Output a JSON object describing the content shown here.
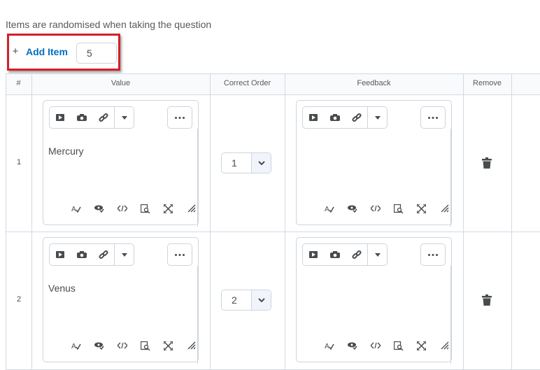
{
  "note": "Items are randomised when taking the question",
  "add_item": {
    "label": "Add Item",
    "plus": "+",
    "count": "5"
  },
  "table": {
    "headers": {
      "num": "#",
      "value": "Value",
      "order": "Correct Order",
      "feedback": "Feedback",
      "remove": "Remove"
    },
    "rows": [
      {
        "num": "1",
        "value": "Mercury",
        "order": "1",
        "feedback": ""
      },
      {
        "num": "2",
        "value": "Venus",
        "order": "2",
        "feedback": ""
      }
    ]
  },
  "icons": {
    "toolbar": [
      "play-icon",
      "camera-icon",
      "link-icon",
      "caret-down-icon"
    ],
    "more": "ellipsis-icon",
    "bottom": [
      "spellcheck-icon",
      "accessibility-check-icon",
      "source-code-icon",
      "preview-icon",
      "fullscreen-icon",
      "resize-handle-icon"
    ],
    "select": "chevron-down-icon",
    "remove": "trash-icon"
  },
  "colors": {
    "accent": "#006fbf",
    "highlight": "#d3202b",
    "border": "#cdd5dc"
  }
}
